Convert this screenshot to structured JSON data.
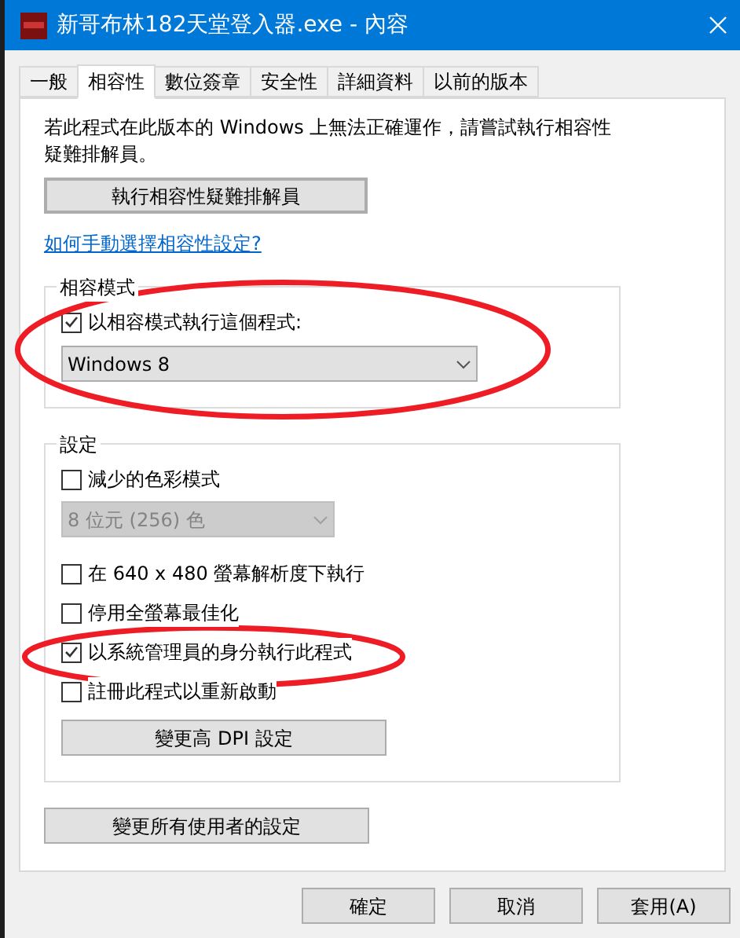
{
  "window": {
    "title": "新哥布林182天堂登入器.exe - 內容"
  },
  "tabs": [
    {
      "label": "一般",
      "selected": false
    },
    {
      "label": "相容性",
      "selected": true
    },
    {
      "label": "數位簽章",
      "selected": false
    },
    {
      "label": "安全性",
      "selected": false
    },
    {
      "label": "詳細資料",
      "selected": false
    },
    {
      "label": "以前的版本",
      "selected": false
    }
  ],
  "description": "若此程式在此版本的 Windows 上無法正確運作，請嘗試執行相容性疑難排解員。",
  "troubleshoot_button": "執行相容性疑難排解員",
  "help_link": "如何手動選擇相容性設定?",
  "compat_mode": {
    "legend": "相容模式",
    "circled": true,
    "checkbox": {
      "label": "以相容模式執行這個程式:",
      "checked": true
    },
    "select": {
      "value": "Windows 8",
      "disabled": false
    }
  },
  "settings": {
    "legend": "設定",
    "items": [
      {
        "kind": "checkbox",
        "label": "減少的色彩模式",
        "checked": false,
        "circled": false
      },
      {
        "kind": "select",
        "value": "8 位元 (256) 色",
        "disabled": true
      },
      {
        "kind": "checkbox",
        "label": "在 640 x 480 螢幕解析度下執行",
        "checked": false,
        "circled": false
      },
      {
        "kind": "checkbox",
        "label": "停用全螢幕最佳化",
        "checked": false,
        "circled": false
      },
      {
        "kind": "checkbox",
        "label": "以系統管理員的身分執行此程式",
        "checked": true,
        "circled": true
      },
      {
        "kind": "checkbox",
        "label": "註冊此程式以重新啟動",
        "checked": false,
        "circled": false
      },
      {
        "kind": "button",
        "label": "變更高 DPI 設定"
      }
    ]
  },
  "all_users_button": "變更所有使用者的設定",
  "buttons": [
    "確定",
    "取消",
    "套用(A)"
  ]
}
